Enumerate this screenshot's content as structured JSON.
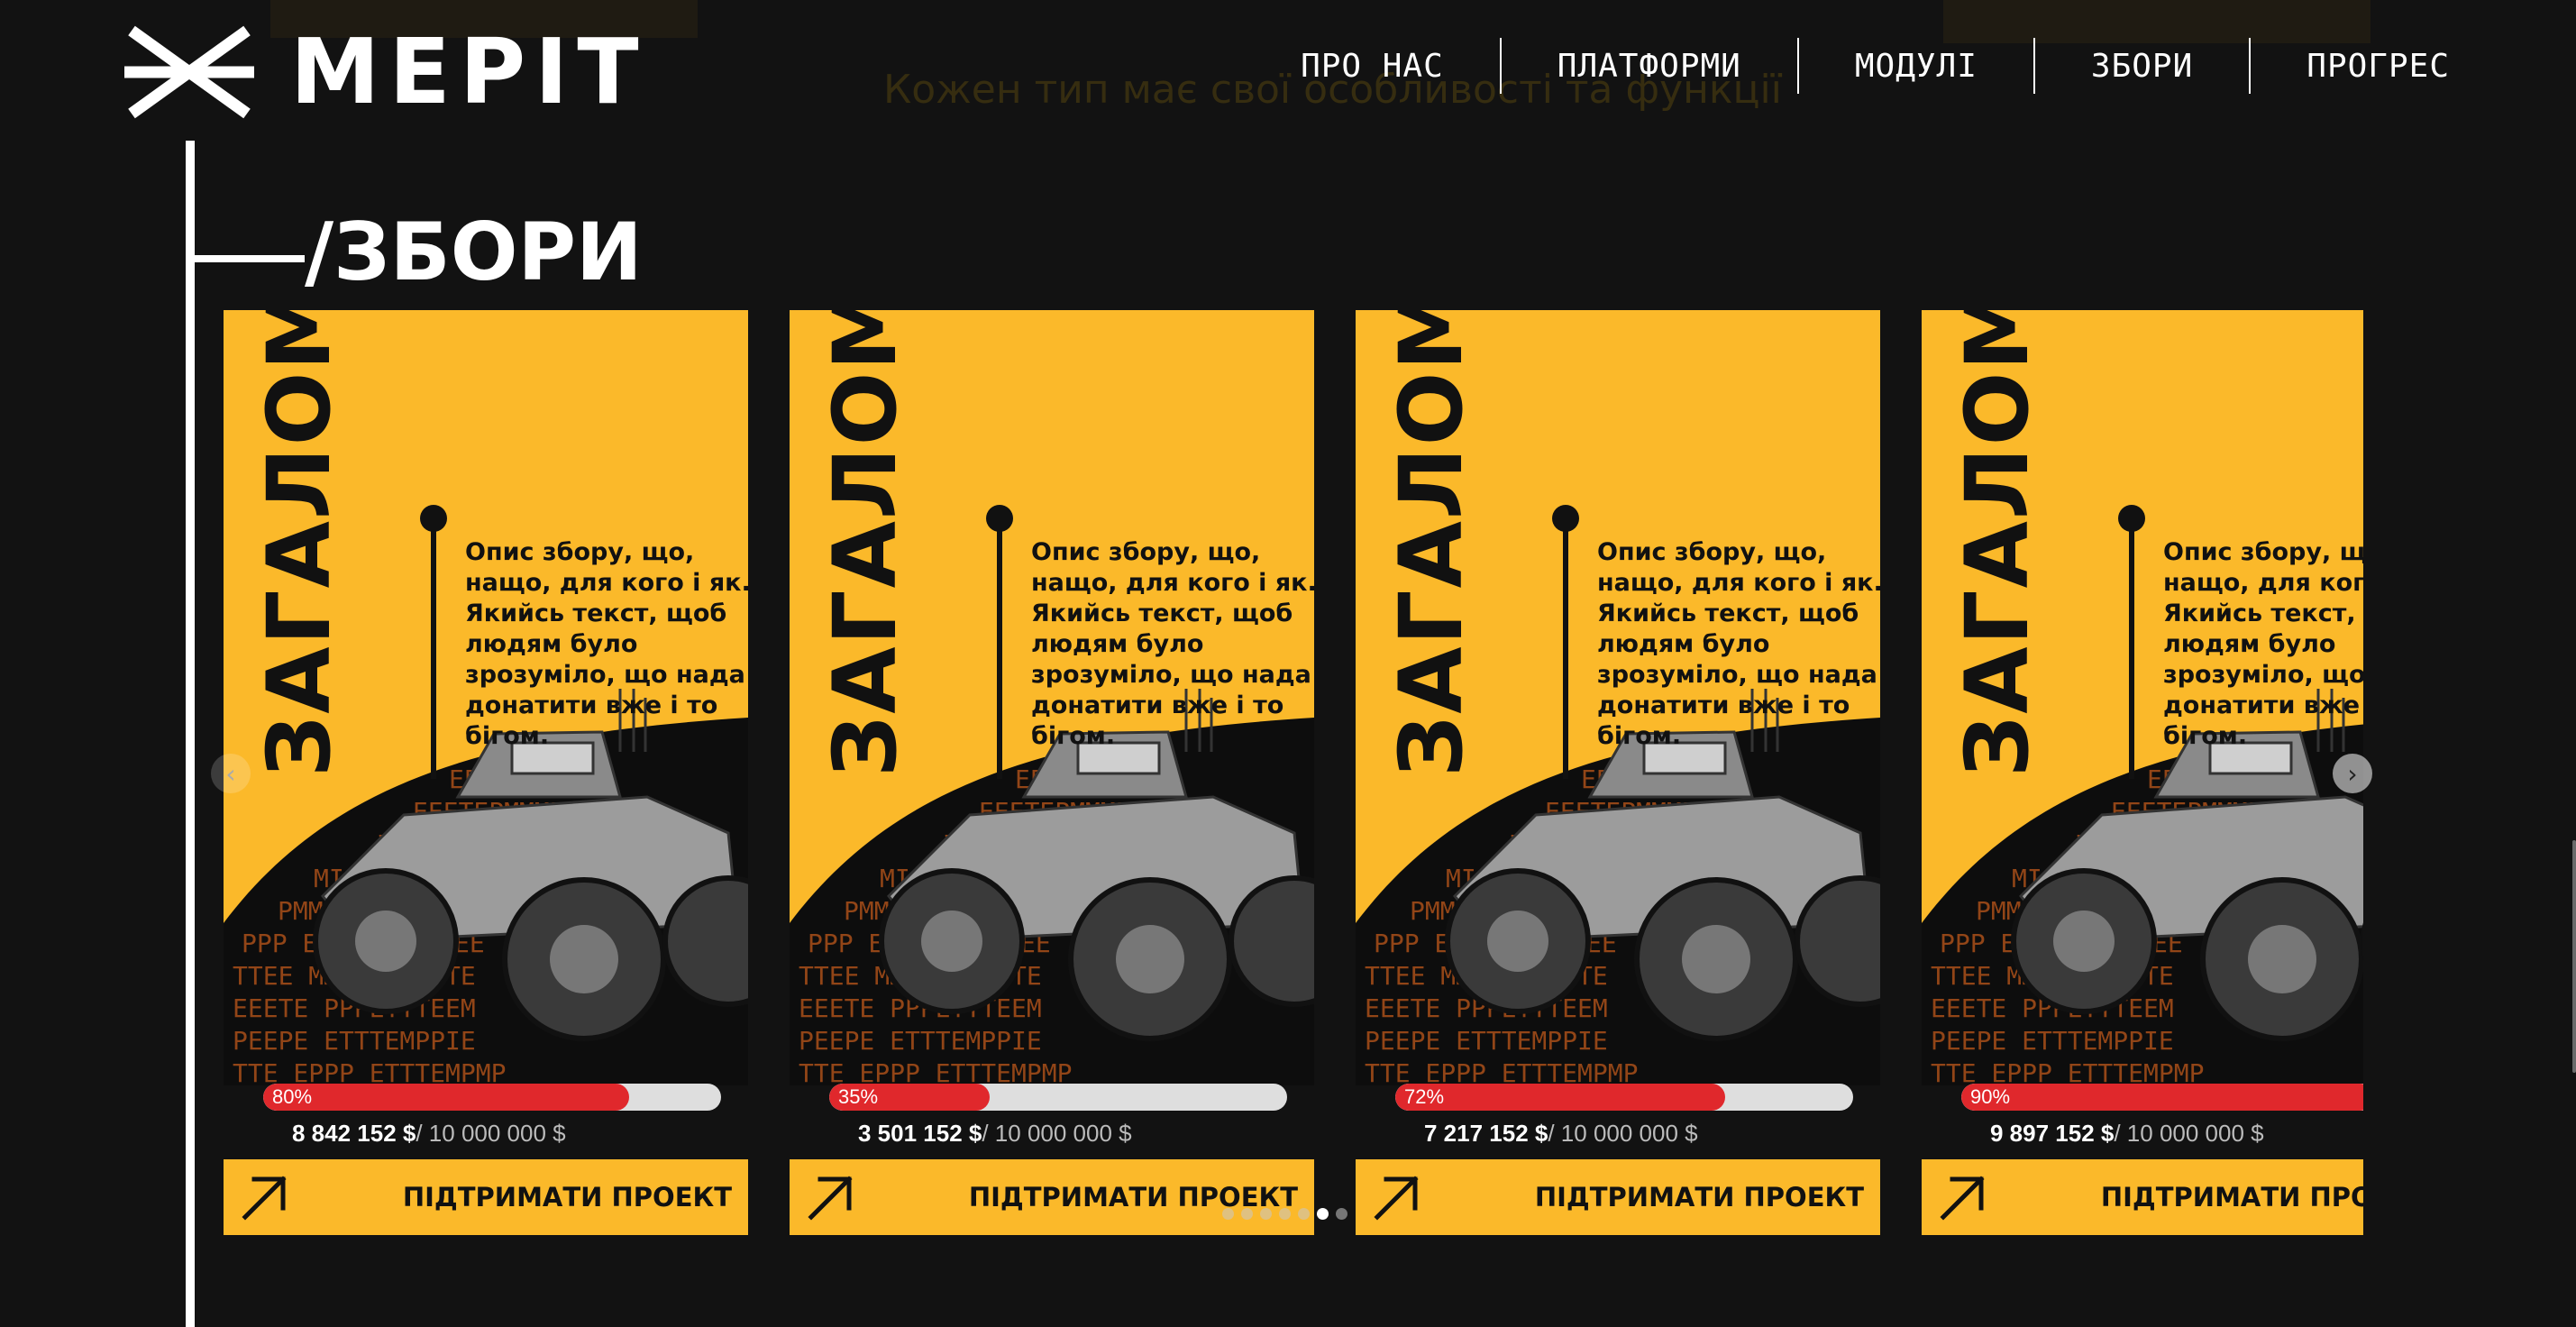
{
  "header": {
    "logo_icon": "asterisk-logo-icon",
    "logo_text": "МЕРІТ",
    "nav": [
      {
        "label": "ПРО НАС"
      },
      {
        "label": "ПЛАТФОРМИ"
      },
      {
        "label": "МОДУЛІ"
      },
      {
        "label": "ЗБОРИ"
      },
      {
        "label": "ПРОГРЕС"
      }
    ]
  },
  "background": {
    "faded_text": "Кожен тип має свої особливості та функції"
  },
  "section": {
    "title": "/ЗБОРИ"
  },
  "carousel": {
    "prev_icon": "chevron-left-icon",
    "next_icon": "chevron-right-icon",
    "cards": [
      {
        "title": "ЗАГАЛОМ",
        "description": "Опис збору, що, нащо, для кого і як. Якийсь текст, щоб людям було зрозуміло, що нада донатити вже і то бігом.",
        "progress_pct": 80,
        "progress_label": "80%",
        "raised": "8 842 152 $",
        "goal": "/ 10 000 000 $",
        "button_label": "ПІДТРИМАТИ ПРОЕКТ",
        "button_icon": "arrow-up-right-icon"
      },
      {
        "title": "ЗАГАЛОМ",
        "description": "Опис збору, що, нащо, для кого і як. Якийсь текст, щоб людям було зрозуміло, що нада донатити вже і то бігом.",
        "progress_pct": 35,
        "progress_label": "35%",
        "raised": "3 501 152 $",
        "goal": "/ 10 000 000 $",
        "button_label": "ПІДТРИМАТИ ПРОЕКТ",
        "button_icon": "arrow-up-right-icon"
      },
      {
        "title": "ЗАГАЛОМ",
        "description": "Опис збору, що, нащо, для кого і як. Якийсь текст, щоб людям було зрозуміло, що нада донатити вже і то бігом.",
        "progress_pct": 72,
        "progress_label": "72%",
        "raised": "7 217 152 $",
        "goal": "/ 10 000 000 $",
        "button_label": "ПІДТРИМАТИ ПРОЕКТ",
        "button_icon": "arrow-up-right-icon"
      },
      {
        "title": "ЗАГАЛОМ",
        "description": "Опис збору, що, нащо, для кого і як. Якийсь текст, щоб людям було зрозуміло, що нада донатити вже і то бігом.",
        "progress_pct": 90,
        "progress_label": "90%",
        "raised": "9 897 152 $",
        "goal": "/ 10 000 000 $",
        "button_label": "ПІДТРИМАТИ ПРОЕКТ",
        "button_icon": "arrow-up-right-icon"
      }
    ],
    "dots_count": 7,
    "active_dot": 5
  },
  "colors": {
    "background": "#121212",
    "accent_yellow": "#fbb92a",
    "progress_red": "#e0282c",
    "progress_track": "#dedede"
  }
}
